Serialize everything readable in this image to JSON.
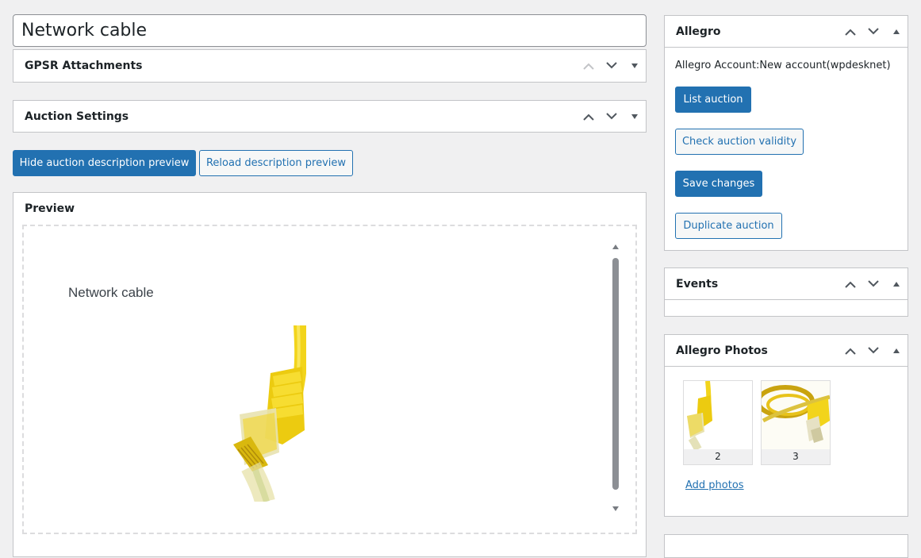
{
  "post": {
    "title": "Network cable"
  },
  "boxes": {
    "gpsr": {
      "title": "GPSR Attachments"
    },
    "auction_settings": {
      "title": "Auction Settings"
    },
    "preview": {
      "title": "Preview"
    }
  },
  "buttons": {
    "hide_preview": "Hide auction description preview",
    "reload_preview": "Reload description preview"
  },
  "preview_content": {
    "product_title": "Network cable"
  },
  "sidebar": {
    "allegro": {
      "title": "Allegro",
      "account_label": "Allegro Account:",
      "account_value": "New account(wpdesknet)",
      "list_auction": "List auction",
      "check_validity": "Check auction validity",
      "save_changes": "Save changes",
      "duplicate_auction": "Duplicate auction"
    },
    "events": {
      "title": "Events"
    },
    "photos": {
      "title": "Allegro Photos",
      "items": [
        {
          "label": "2"
        },
        {
          "label": "3"
        }
      ],
      "add_link": "Add photos"
    }
  },
  "colors": {
    "primary": "#2271b1",
    "cable_yellow": "#f2d41b"
  },
  "icons": {
    "move_up": "chevron-up-icon",
    "move_down": "chevron-down-icon",
    "toggle": "triangle-toggle-icon"
  }
}
